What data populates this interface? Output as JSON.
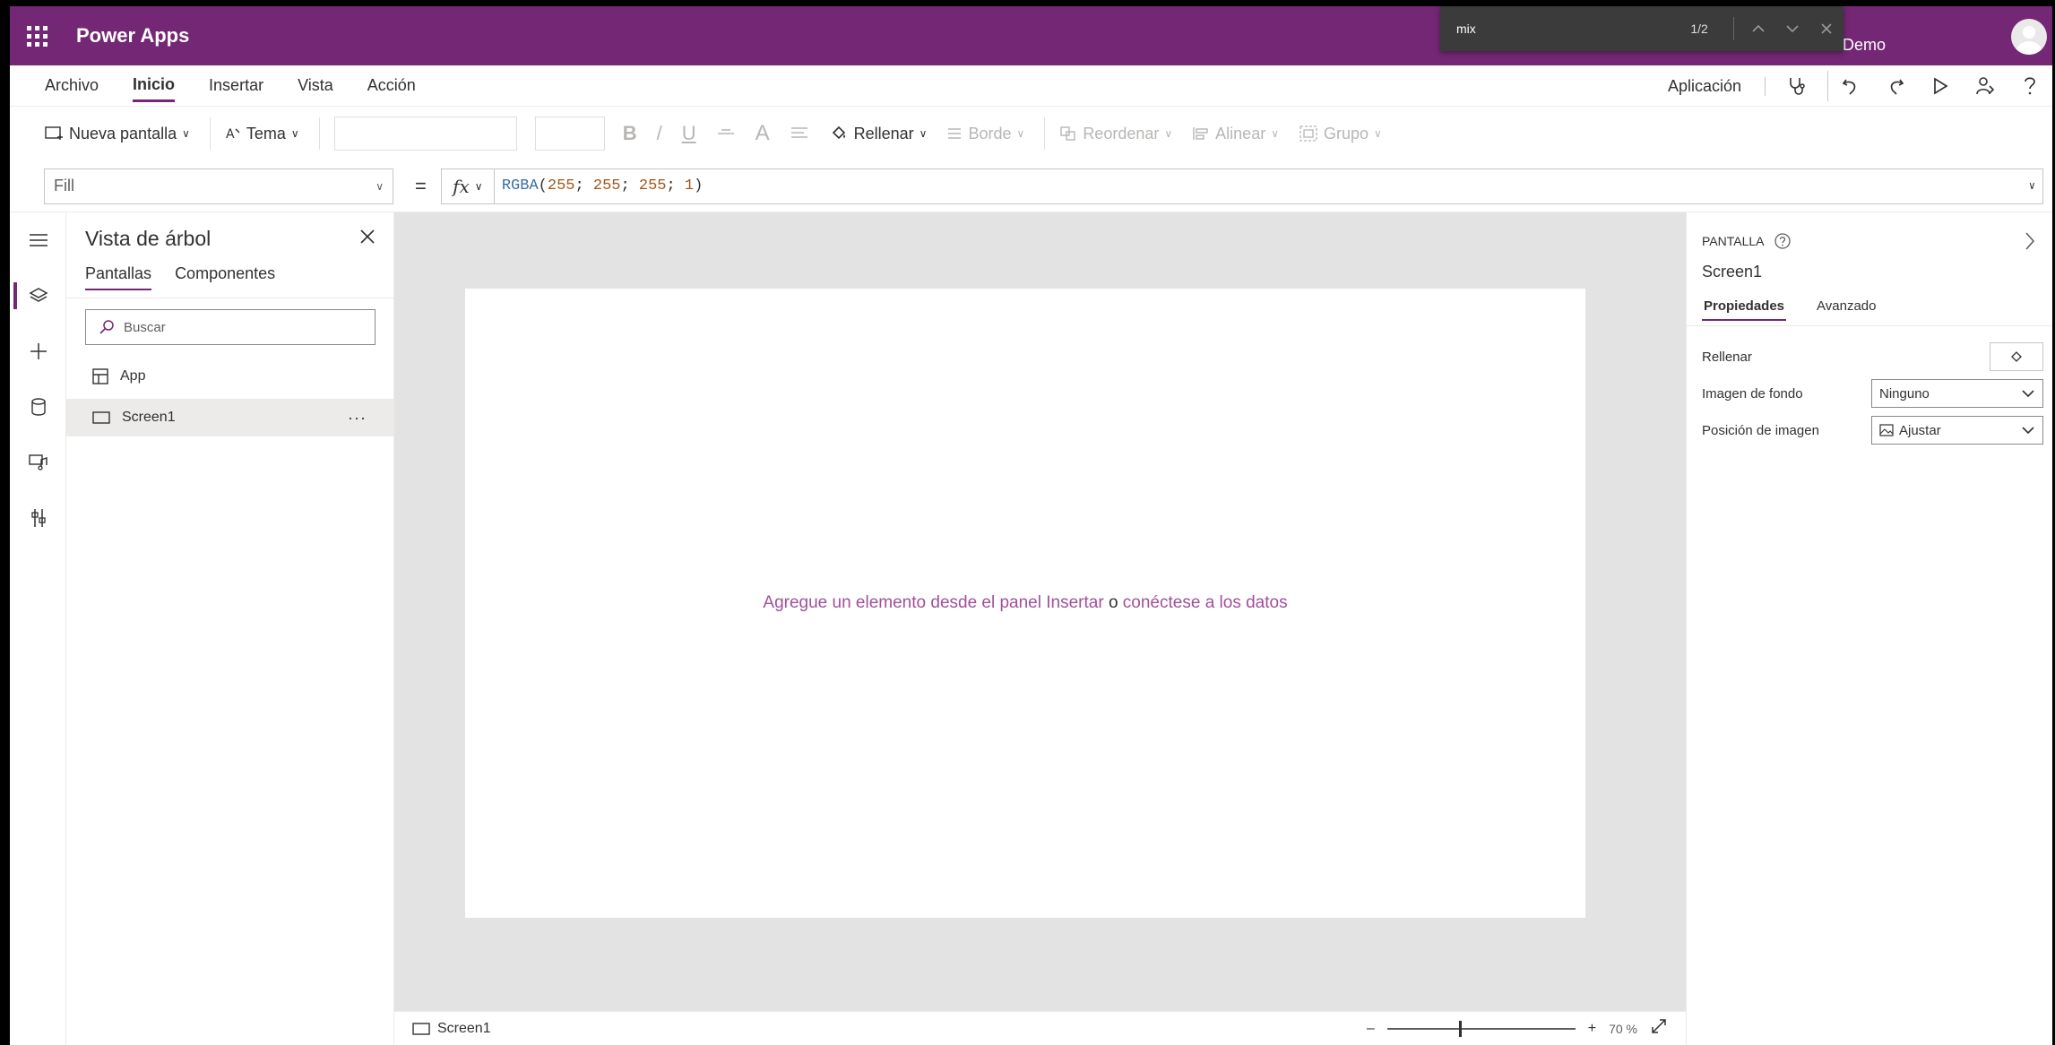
{
  "topbar": {
    "app_title": "Power Apps",
    "env_label": "Demo"
  },
  "findbar": {
    "query": "mix",
    "count": "1/2"
  },
  "menu": {
    "items": [
      "Archivo",
      "Inicio",
      "Insertar",
      "Vista",
      "Acción"
    ],
    "active": "Inicio",
    "app_button": "Aplicación"
  },
  "toolbar": {
    "new_screen": "Nueva pantalla",
    "theme": "Tema",
    "bold": "B",
    "italic": "/",
    "underline": "U",
    "font_color": "A",
    "fill": "Rellenar",
    "border": "Borde",
    "reorder": "Reordenar",
    "align": "Alinear",
    "group": "Grupo"
  },
  "formula": {
    "property": "Fill",
    "equals": "=",
    "fx": "fx",
    "fn": "RGBA",
    "open": "(",
    "a": "255",
    "b": "255",
    "c": "255",
    "d": "1",
    "sep": "; ",
    "close": ")"
  },
  "tree": {
    "title": "Vista de árbol",
    "tabs": [
      "Pantallas",
      "Componentes"
    ],
    "search_placeholder": "Buscar",
    "items": [
      "App",
      "Screen1"
    ],
    "more": "···"
  },
  "canvas": {
    "msg_part1": "Agregue un elemento desde el panel Insertar",
    "msg_connector": " o ",
    "msg_part2": "conéctese a los datos"
  },
  "status": {
    "screen": "Screen1",
    "zoom_minus": "–",
    "zoom_plus": "+",
    "zoom_value": "70",
    "zoom_unit": "%",
    "zoom_level": 0.38
  },
  "props": {
    "kind": "PANTALLA",
    "name": "Screen1",
    "tabs": [
      "Propiedades",
      "Avanzado"
    ],
    "fill_label": "Rellenar",
    "bg_image_label": "Imagen de fondo",
    "bg_image_value": "Ninguno",
    "img_pos_label": "Posición de imagen",
    "img_pos_value": "Ajustar"
  },
  "colors": {
    "brand": "#742774",
    "link": "#a0509a"
  }
}
